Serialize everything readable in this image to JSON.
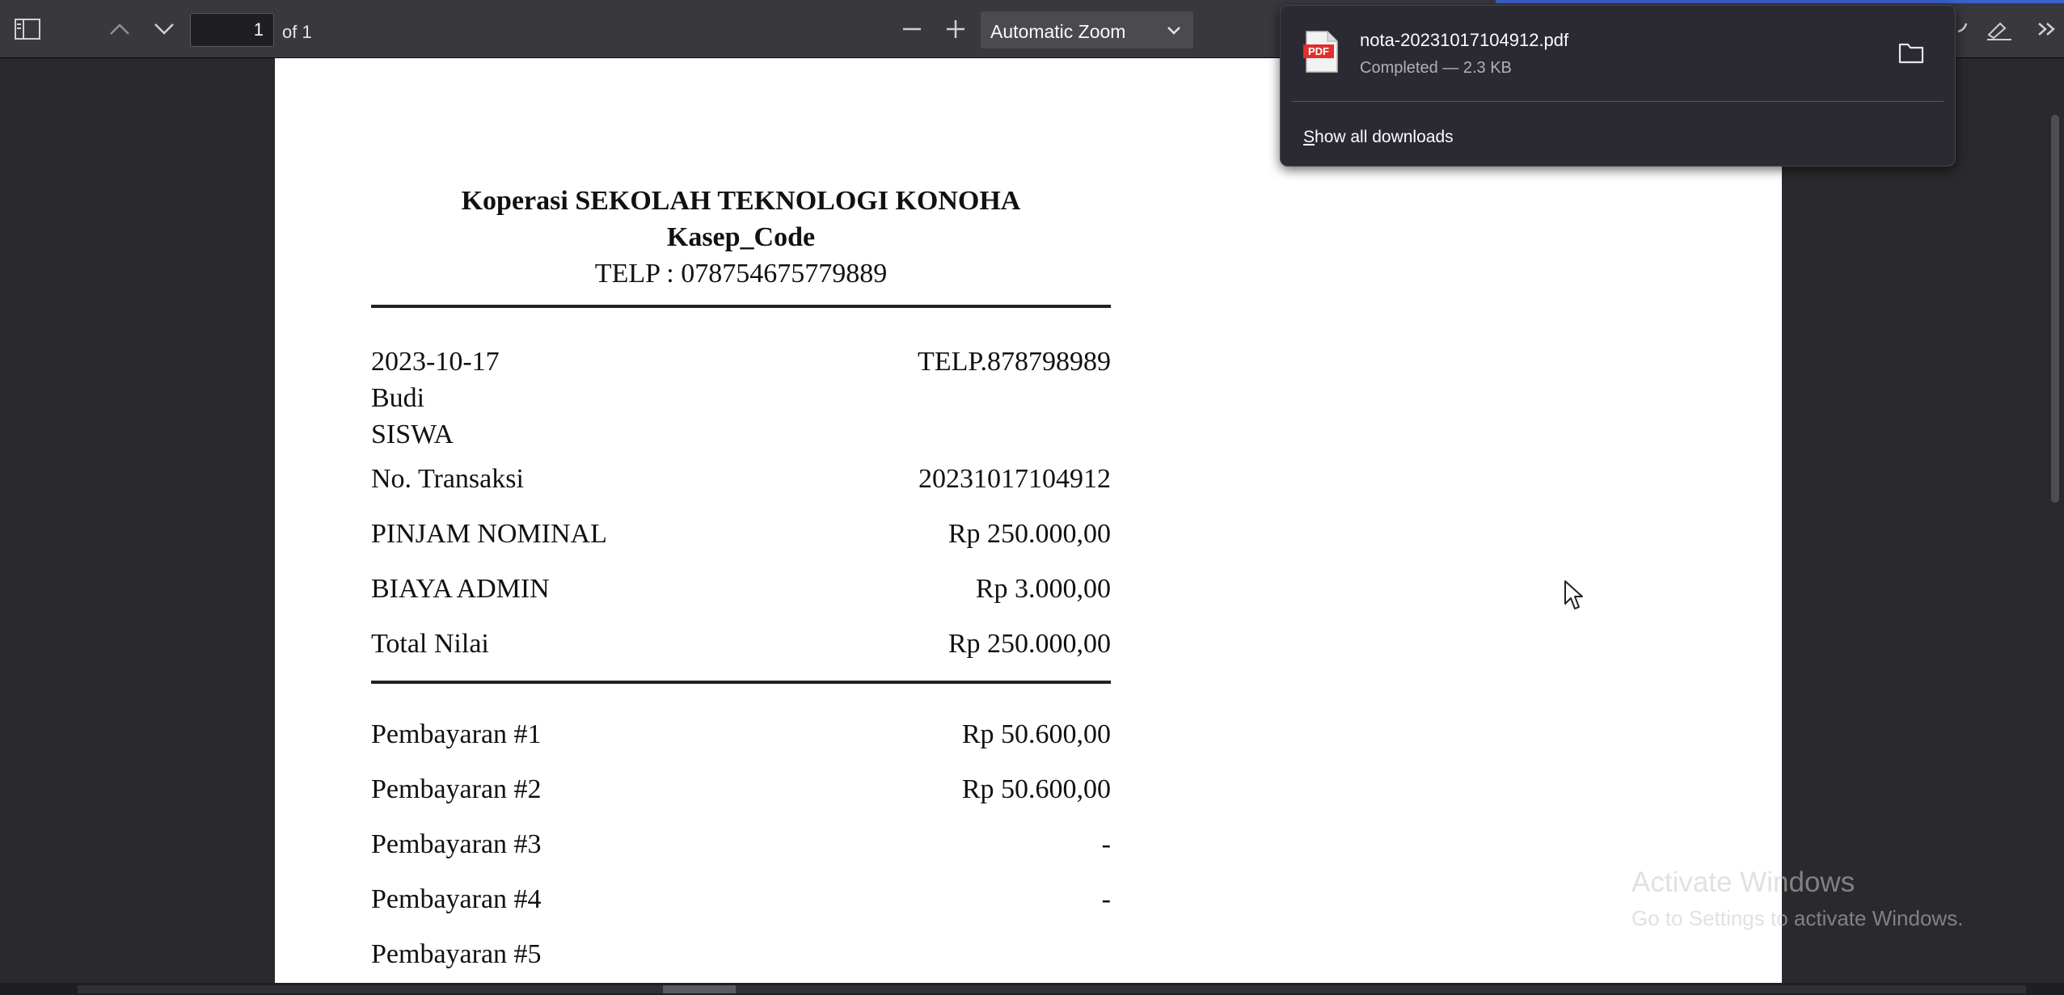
{
  "toolbar": {
    "page_number": "1",
    "page_of": "of 1",
    "zoom_label": "Automatic Zoom"
  },
  "receipt": {
    "org_name": "Koperasi SEKOLAH TEKNOLOGI KONOHA",
    "subtitle": "Kasep_Code",
    "phone_line": "TELP : 078754675779889",
    "date": "2023-10-17",
    "member_phone": "TELP.878798989",
    "member_name": "Budi",
    "member_role": "SISWA",
    "transaction": {
      "label": "No. Transaksi",
      "value": "20231017104912"
    },
    "summary": [
      {
        "label": "PINJAM NOMINAL",
        "value": "Rp 250.000,00"
      },
      {
        "label": "BIAYA ADMIN",
        "value": "Rp 3.000,00"
      },
      {
        "label": "Total Nilai",
        "value": "Rp 250.000,00"
      }
    ],
    "payments": [
      {
        "label": "Pembayaran #1",
        "value": "Rp 50.600,00"
      },
      {
        "label": "Pembayaran #2",
        "value": "Rp 50.600,00"
      },
      {
        "label": "Pembayaran #3",
        "value": "-"
      },
      {
        "label": "Pembayaran #4",
        "value": "-"
      },
      {
        "label": "Pembayaran #5",
        "value": ""
      }
    ]
  },
  "downloads": {
    "file_name": "nota-20231017104912.pdf",
    "status": "Completed — 2.3 KB",
    "show_all_prefix": "S",
    "show_all_rest": "how all downloads"
  },
  "watermark": {
    "title": "Activate Windows",
    "subtitle": "Go to Settings to activate Windows."
  },
  "colors": {
    "toolbar_bg": "#38383d",
    "viewer_bg": "#2a2a2e",
    "popup_bg": "#2b2a33",
    "pdf_icon_red": "#e0302e",
    "accent_blue": "#3b62c9"
  }
}
